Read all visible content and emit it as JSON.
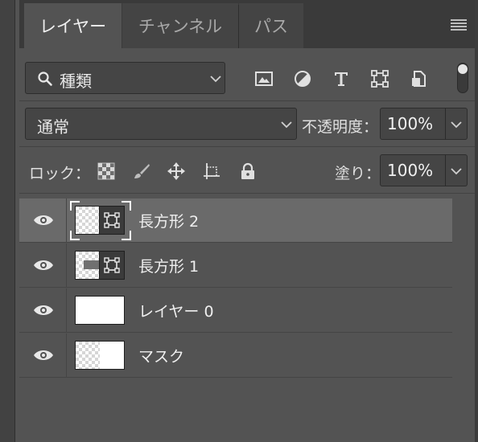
{
  "tabs": [
    {
      "label": "レイヤー",
      "active": true
    },
    {
      "label": "チャンネル",
      "active": false
    },
    {
      "label": "パス",
      "active": false
    }
  ],
  "filter": {
    "kind_label": "種類",
    "icons": [
      "image-filter-icon",
      "adjustment-filter-icon",
      "type-filter-icon",
      "shape-filter-icon",
      "smart-object-filter-icon"
    ],
    "filter_toggle_on": true
  },
  "blend": {
    "mode": "通常",
    "opacity_label": "不透明度：",
    "opacity_value": "100%"
  },
  "lock": {
    "label": "ロック：",
    "icons": [
      "lock-transparent-pixels-icon",
      "lock-image-pixels-icon",
      "lock-position-icon",
      "lock-artboard-icon",
      "lock-all-icon"
    ],
    "fill_label": "塗り：",
    "fill_value": "100%"
  },
  "layers": [
    {
      "name": "長方形 2",
      "selected": true,
      "visible": true,
      "type": "shape"
    },
    {
      "name": "長方形 1",
      "selected": false,
      "visible": true,
      "type": "shape"
    },
    {
      "name": "レイヤー 0",
      "selected": false,
      "visible": true,
      "type": "pixel"
    },
    {
      "name": "マスク",
      "selected": false,
      "visible": true,
      "type": "pixel"
    }
  ],
  "colors": {
    "panel_bg": "#535353",
    "selected_row": "#6a6a6a",
    "tab_bar": "#3a3a3a",
    "field_bg": "#454545"
  }
}
